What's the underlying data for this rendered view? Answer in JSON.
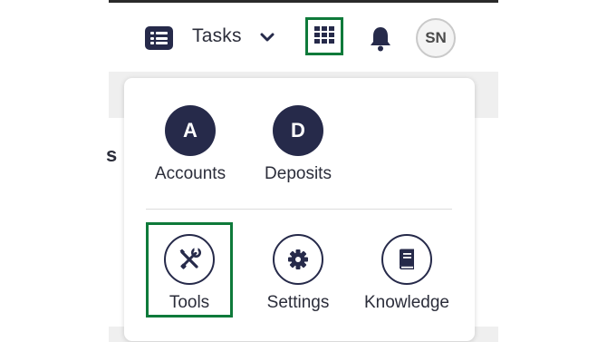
{
  "header": {
    "tasks_label": "Tasks",
    "avatar_initials": "SN",
    "icons": {
      "tasks": "list-icon",
      "dropdown": "chevron-down-icon",
      "apps": "grid-icon",
      "notifications": "bell-icon"
    }
  },
  "background": {
    "fragment_text": "s"
  },
  "app_menu": {
    "primary_apps": [
      {
        "initial": "A",
        "label": "Accounts"
      },
      {
        "initial": "D",
        "label": "Deposits"
      }
    ],
    "secondary_apps": [
      {
        "icon": "tools-icon",
        "label": "Tools",
        "highlighted": true
      },
      {
        "icon": "gear-icon",
        "label": "Settings"
      },
      {
        "icon": "book-icon",
        "label": "Knowledge"
      }
    ]
  },
  "colors": {
    "navy": "#262a4a",
    "highlight_green": "#0e7a3a",
    "text": "#2b2d3a"
  }
}
